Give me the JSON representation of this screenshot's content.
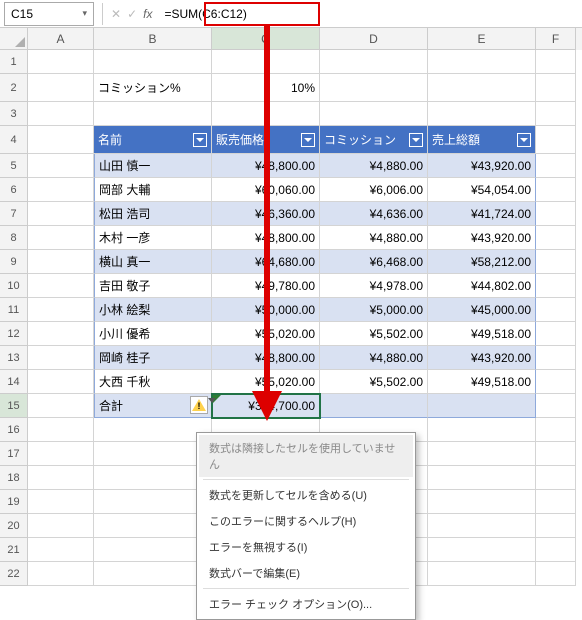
{
  "formula_bar": {
    "cell_ref": "C15",
    "formula": "=SUM(C6:C12)"
  },
  "columns": {
    "A": "A",
    "B": "B",
    "C": "C",
    "D": "D",
    "E": "E",
    "F": "F"
  },
  "rows": [
    "1",
    "2",
    "3",
    "4",
    "5",
    "6",
    "7",
    "8",
    "9",
    "10",
    "11",
    "12",
    "13",
    "14",
    "15",
    "16",
    "17",
    "18",
    "19",
    "20",
    "21",
    "22"
  ],
  "labels": {
    "commission_pct": "コミッション%",
    "commission_val": "10%"
  },
  "table": {
    "headers": {
      "name": "名前",
      "price": "販売価格",
      "commission": "コミッション",
      "total": "売上総額"
    },
    "rows": [
      {
        "name": "山田 慎一",
        "price": "¥48,800.00",
        "comm": "¥4,880.00",
        "tot": "¥43,920.00"
      },
      {
        "name": "岡部 大輔",
        "price": "¥60,060.00",
        "comm": "¥6,006.00",
        "tot": "¥54,054.00"
      },
      {
        "name": "松田 浩司",
        "price": "¥46,360.00",
        "comm": "¥4,636.00",
        "tot": "¥41,724.00"
      },
      {
        "name": "木村 一彦",
        "price": "¥48,800.00",
        "comm": "¥4,880.00",
        "tot": "¥43,920.00"
      },
      {
        "name": "横山 真一",
        "price": "¥64,680.00",
        "comm": "¥6,468.00",
        "tot": "¥58,212.00"
      },
      {
        "name": "吉田 敬子",
        "price": "¥49,780.00",
        "comm": "¥4,978.00",
        "tot": "¥44,802.00"
      },
      {
        "name": "小林 絵梨",
        "price": "¥50,000.00",
        "comm": "¥5,000.00",
        "tot": "¥45,000.00"
      },
      {
        "name": "小川 優希",
        "price": "¥55,020.00",
        "comm": "¥5,502.00",
        "tot": "¥49,518.00"
      },
      {
        "name": "岡崎 桂子",
        "price": "¥48,800.00",
        "comm": "¥4,880.00",
        "tot": "¥43,920.00"
      },
      {
        "name": "大西 千秋",
        "price": "¥55,020.00",
        "comm": "¥5,502.00",
        "tot": "¥49,518.00"
      }
    ],
    "footer": {
      "label": "合計",
      "value": "¥374,700.00"
    }
  },
  "context_menu": {
    "items": [
      "数式は隣接したセルを使用していません",
      "数式を更新してセルを含める(U)",
      "このエラーに関するヘルプ(H)",
      "エラーを無視する(I)",
      "数式バーで編集(E)",
      "エラー チェック オプション(O)..."
    ]
  }
}
